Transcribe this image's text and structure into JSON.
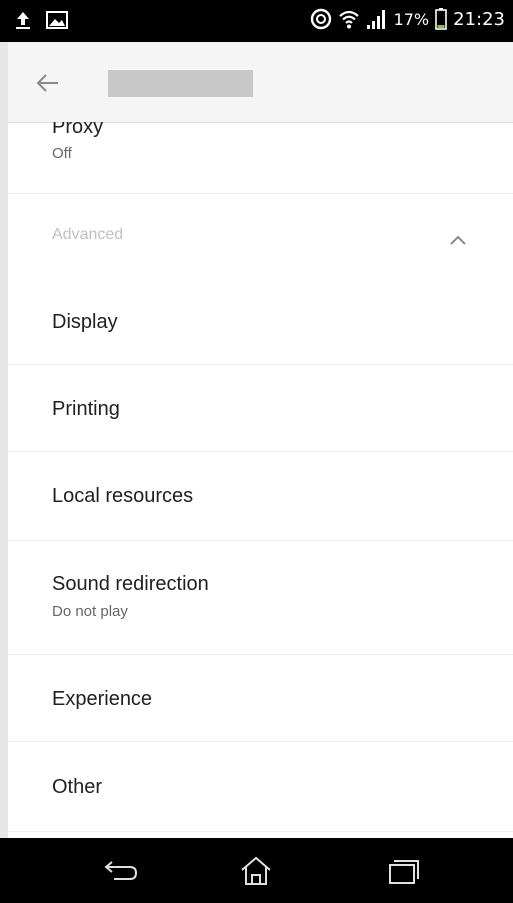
{
  "status_bar": {
    "battery_percent": "17%",
    "time": "21:23",
    "icons": [
      "upload-icon",
      "image-icon",
      "sync-icon",
      "wifi-icon",
      "signal-icon",
      "battery-icon"
    ]
  },
  "app_bar": {
    "back_icon": "back-arrow-icon"
  },
  "list": {
    "proxy": {
      "title": "Proxy",
      "subtitle": "Off"
    },
    "advanced_header": {
      "label": "Advanced",
      "icon": "chevron-up-icon"
    },
    "items": [
      {
        "title": "Display"
      },
      {
        "title": "Printing"
      },
      {
        "title": "Local resources"
      },
      {
        "title": "Sound redirection",
        "subtitle": "Do not play"
      },
      {
        "title": "Experience"
      },
      {
        "title": "Other"
      }
    ]
  },
  "nav_bar": {
    "icons": [
      "back-icon",
      "home-icon",
      "recents-icon"
    ]
  }
}
